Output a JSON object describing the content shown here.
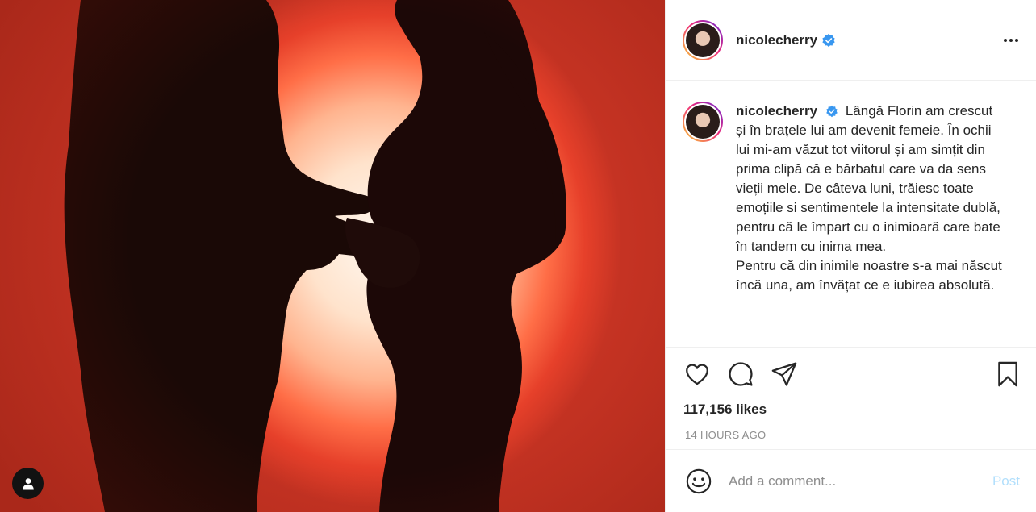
{
  "post": {
    "photo": {
      "description_icon": "user-tag-icon",
      "colors": {
        "glow": "#fff2e6",
        "background": "#d63b27",
        "silhouette": "#1a0a08"
      }
    },
    "header": {
      "username": "nicolecherry",
      "verified_icon": "verified-badge-icon",
      "more_icon": "more-options-icon"
    },
    "caption": {
      "username": "nicolecherry",
      "text": "Lângă Florin am crescut și în brațele lui am devenit femeie. În ochii lui mi-am văzut tot viitorul și am simțit din prima clipă că e bărbatul care va da sens vieții mele. De câteva luni, trăiesc toate emoțiile si sentimentele la intensitate dublă, pentru că le împart cu o inimioară care bate în tandem cu inima mea.\nPentru că din inimile noastre s-a mai născut încă una, am învățat ce e iubirea absolută."
    },
    "actions": {
      "like_icon": "heart-icon",
      "comment_icon": "comment-icon",
      "share_icon": "paper-plane-icon",
      "save_icon": "bookmark-icon"
    },
    "likes": "117,156 likes",
    "timestamp": "14 HOURS AGO",
    "comment": {
      "emoji_icon": "smiley-icon",
      "placeholder": "Add a comment...",
      "post_label": "Post",
      "post_color": "#b2dffc"
    },
    "brand_colors": {
      "text": "#262626",
      "muted": "#8e8e8e",
      "verified": "#3897f0",
      "border": "#efefef"
    }
  }
}
